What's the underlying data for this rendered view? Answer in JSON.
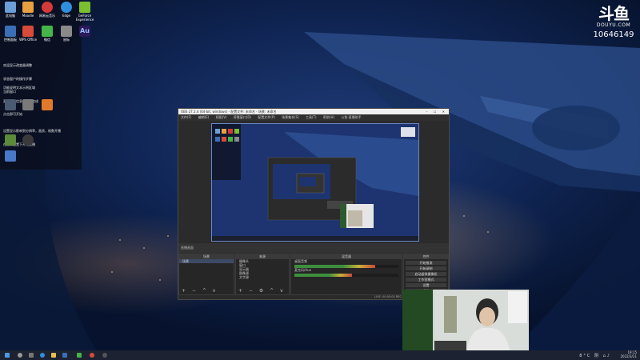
{
  "desktop": {
    "icons_row1": [
      {
        "label": "此电脑",
        "color": "#6a9fd8"
      },
      {
        "label": "Moodle",
        "color": "#e8a040"
      },
      {
        "label": "网易云音乐",
        "color": "#d33a3a"
      },
      {
        "label": "Edge",
        "color": "#2f8fdc"
      },
      {
        "label": "GeForce Experience",
        "color": "#7bbf30"
      }
    ],
    "icons_row2": [
      {
        "label": "控制面板",
        "color": "#3a6fb8"
      },
      {
        "label": "WPS Office",
        "color": "#d84a3a"
      },
      {
        "label": "微信",
        "color": "#44b548"
      },
      {
        "label": "鼠标",
        "color": "#8a8a8a"
      },
      {
        "label": "Au",
        "color": "#2a1a5a"
      }
    ],
    "info_lines_top": [
      "欢迎显示改变器调整",
      "",
      "",
      "状态窗户的操作步骤",
      "当前窗口",
      "Live",
      "开启"
    ],
    "info_lines_mid": [
      "功能说明文本示例区域",
      "直播设置信息已加载完成",
      "点击即可开始"
    ],
    "info_lines_bottom": [
      "设置显示影响到分辨率，画质，帧数开播",
      "在当前配置下开始直播"
    ]
  },
  "douyu": {
    "logo_text": "斗鱼",
    "site": "DOUYU.COM",
    "room_id": "10646149"
  },
  "obs": {
    "title": "OBS 27.2.4 (64-bit, windows) - 配置文件: 未命名 - 场景: 未命名",
    "menu": [
      "文件(F)",
      "编辑(E)",
      "视图(V)",
      "停靠窗口(D)",
      "配置文件(P)",
      "场景集合(S)",
      "工具(T)",
      "帮助(H)",
      "斗鱼·直播助手"
    ],
    "preview_label": "直播画面",
    "scenes_title": "场景",
    "scenes": [
      "场景"
    ],
    "sources_title": "来源",
    "sources": [
      "摄像头",
      "窗口",
      "显示器",
      "图像源",
      "文字源"
    ],
    "mixer_title": "混音器",
    "mixer": [
      {
        "name": "桌面音频",
        "level": 0.78
      },
      {
        "name": "麦克风/Aux",
        "level": 0.55
      }
    ],
    "controls_title": "控件",
    "controls": [
      "开始推流",
      "开始录制",
      "启动虚拟摄像机",
      "工作室模式",
      "设置",
      "退出"
    ],
    "status": "LIVE: 00:00:00   REC: 00:00:00   CPU: 1.4%, 30.00 fps"
  },
  "taskbar": {
    "weather": "8°C 阴",
    "time": "19:15",
    "date": "2022/3/21"
  }
}
